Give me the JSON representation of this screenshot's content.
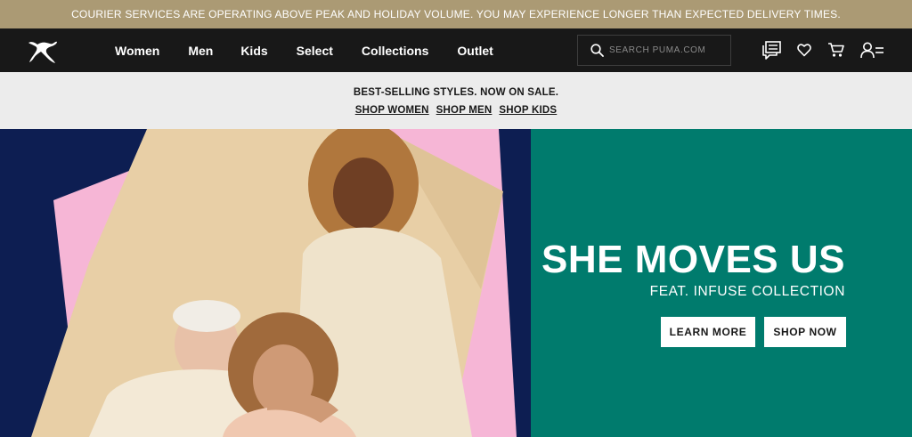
{
  "announcement": "COURIER SERVICES ARE OPERATING ABOVE PEAK AND HOLIDAY VOLUME. YOU MAY EXPERIENCE LONGER THAN EXPECTED DELIVERY TIMES.",
  "nav": {
    "logo": "puma-cat-logo",
    "links": [
      "Women",
      "Men",
      "Kids",
      "Select",
      "Collections",
      "Outlet"
    ],
    "search_placeholder": "SEARCH PUMA.COM",
    "icons": [
      "chat-icon",
      "heart-icon",
      "cart-icon",
      "account-icon"
    ]
  },
  "promo": {
    "title": "BEST-SELLING STYLES. NOW ON SALE.",
    "links": [
      "SHOP WOMEN",
      "SHOP MEN",
      "SHOP KIDS"
    ]
  },
  "hero": {
    "title": "SHE MOVES US",
    "subtitle": "FEAT. INFUSE COLLECTION",
    "learn_more": "LEARN MORE",
    "shop_now": "SHOP NOW"
  },
  "colors": {
    "announcement_bg": "#ab9a74",
    "nav_bg": "#181818",
    "promo_bg": "#ececec",
    "hero_left_bg": "#0d1e52",
    "hero_right_bg": "#007b6d",
    "accent_pink": "#f6b6d6"
  }
}
